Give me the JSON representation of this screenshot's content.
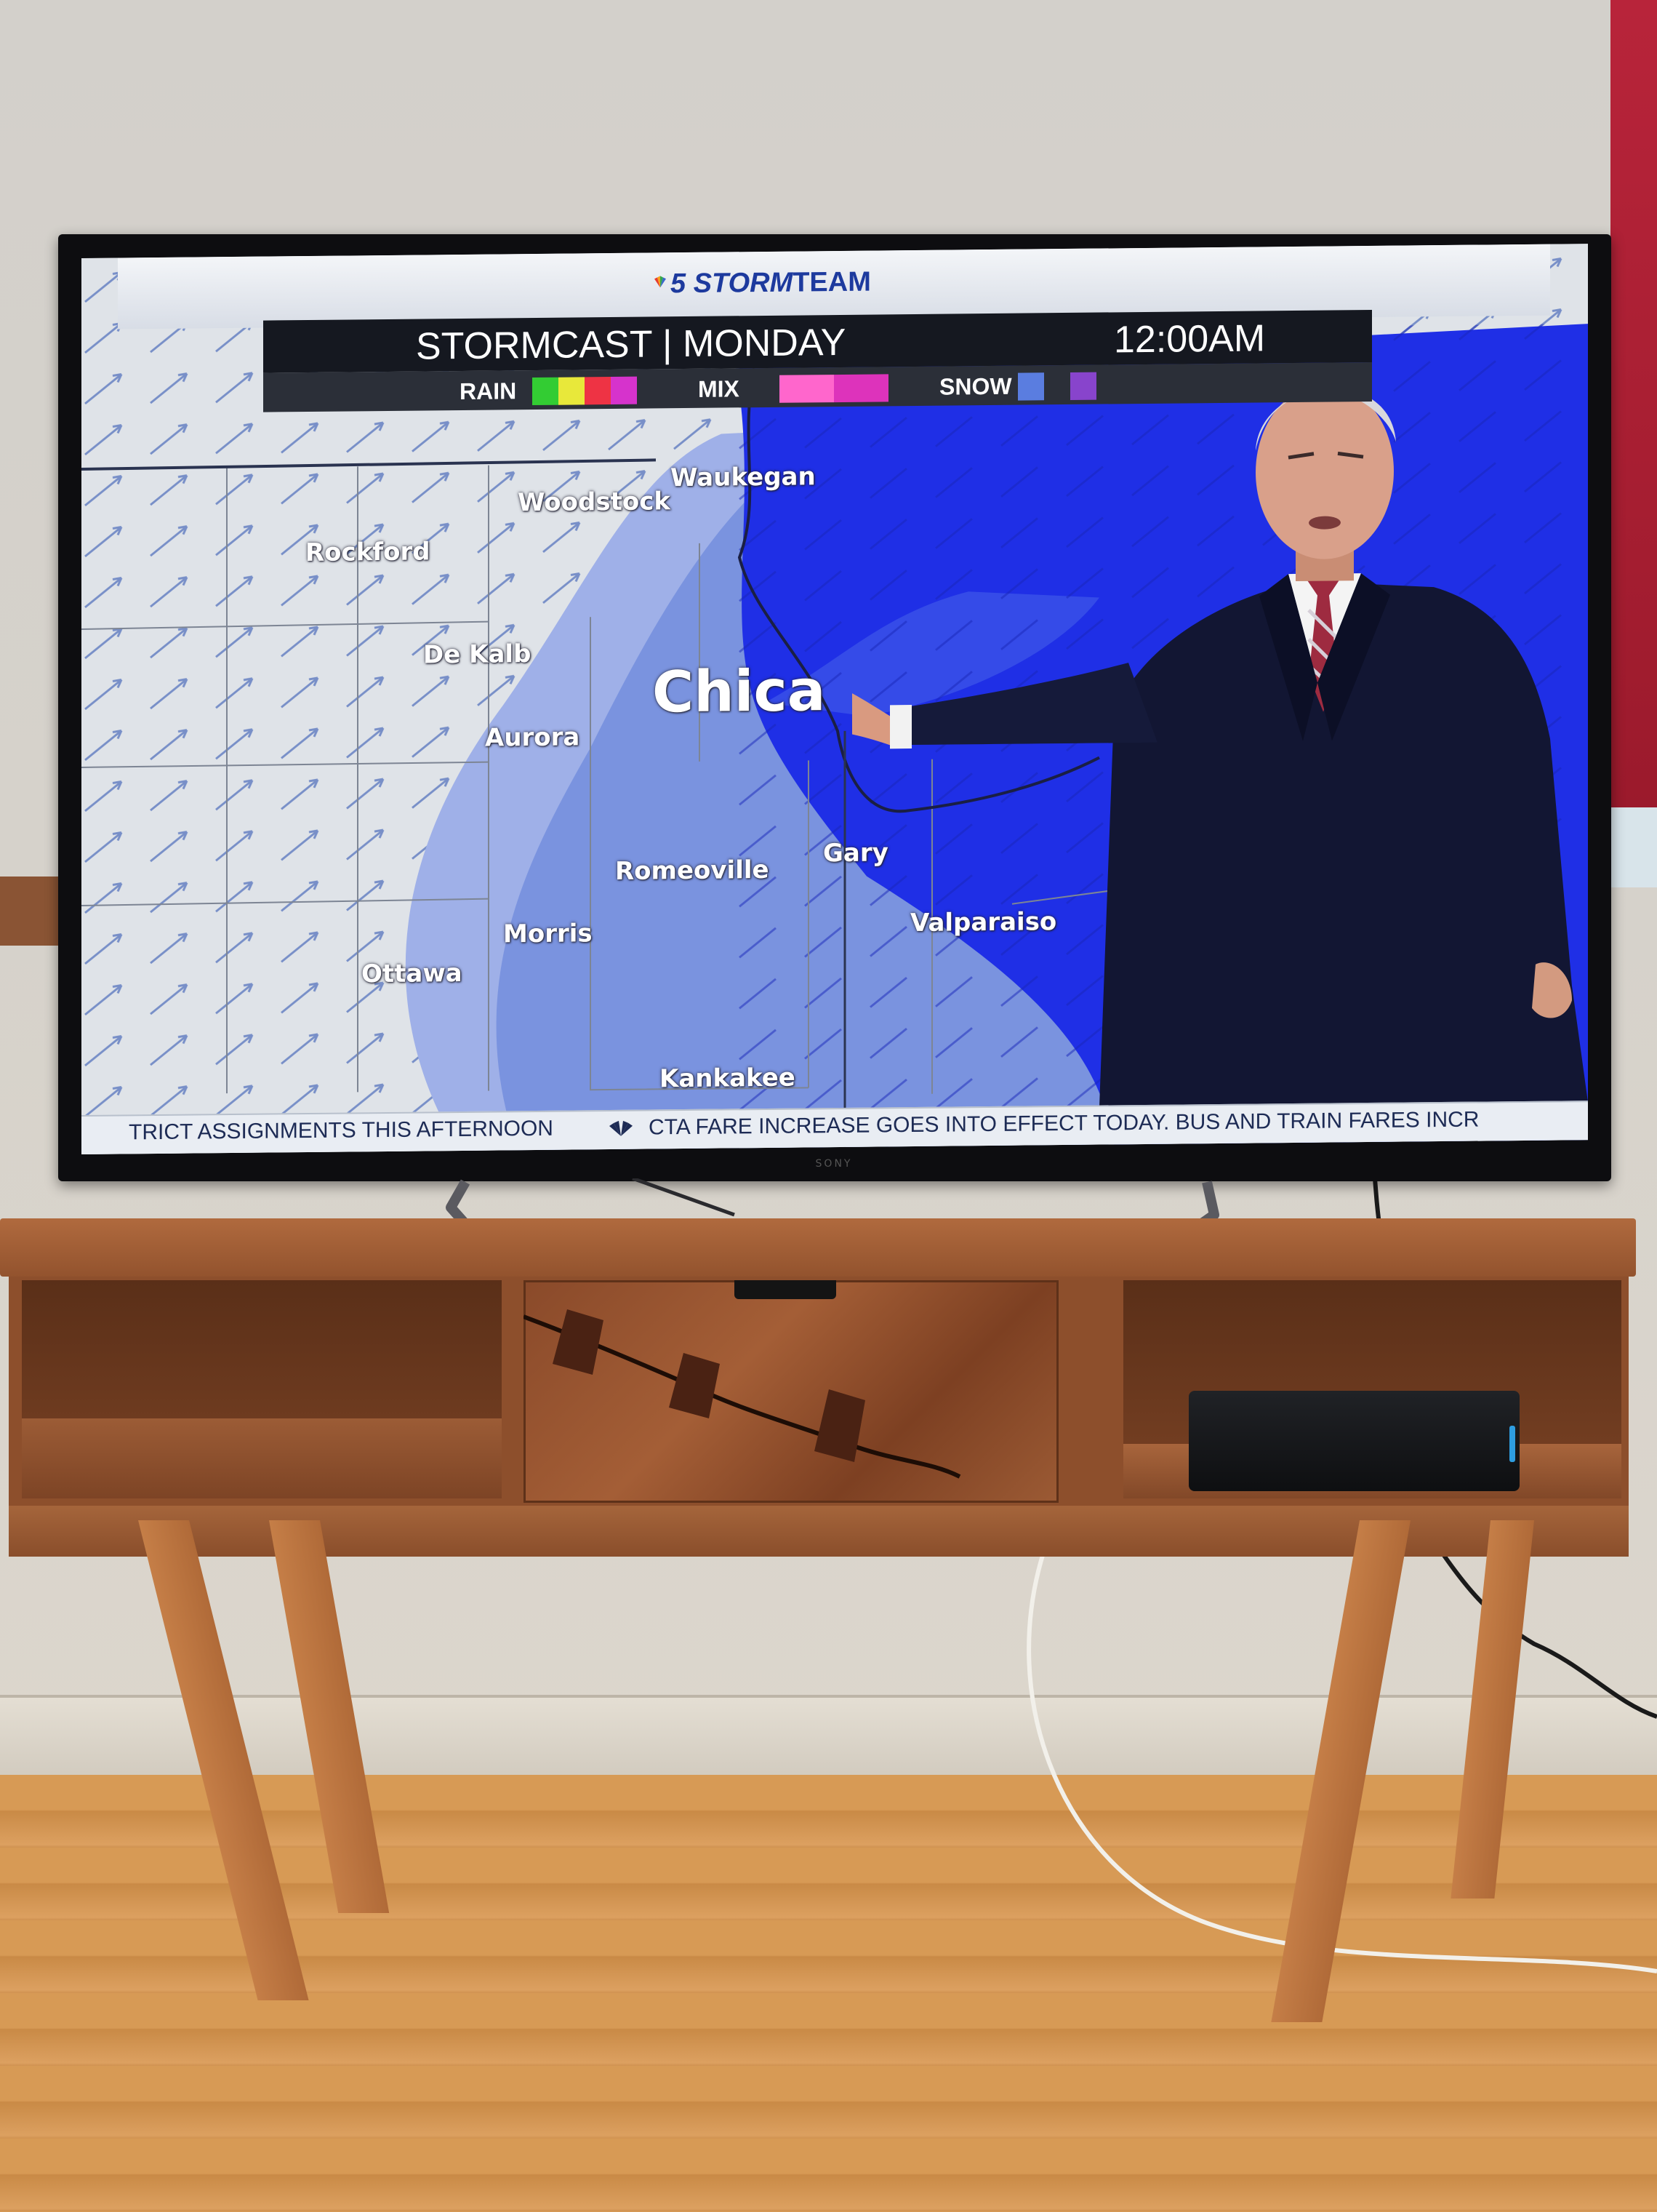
{
  "broadcast": {
    "logo": "5 STORMTEAM",
    "logo_prefix": "5 STORM",
    "logo_suffix": "TEAM",
    "title": "STORMCAST | MONDAY",
    "time": "12:00AM"
  },
  "legend": {
    "rain_label": "RAIN",
    "mix_label": "MIX",
    "snow_label": "SNOW",
    "rain_colors": [
      "#33cc33",
      "#e8e83a",
      "#ee3344",
      "#d633cc"
    ],
    "mix_colors": [
      "#ff66cc",
      "#dd33bb"
    ],
    "snow_colors": [
      "#5a7de0",
      "#8844cc",
      "#cc33cc"
    ]
  },
  "map": {
    "cities": [
      {
        "name": "Waukegan"
      },
      {
        "name": "Woodstock"
      },
      {
        "name": "Rockford"
      },
      {
        "name": "De Kalb"
      },
      {
        "name": "Chica"
      },
      {
        "name": "Aurora"
      },
      {
        "name": "Gary"
      },
      {
        "name": "Romeoville"
      },
      {
        "name": "Valparaiso"
      },
      {
        "name": "Morris"
      },
      {
        "name": "Ottawa"
      },
      {
        "name": "Kankakee"
      }
    ],
    "snow_color": "#1f2fe6",
    "light_snow_color": "#7a93df"
  },
  "ticker": {
    "text_left": "TRICT ASSIGNMENTS THIS AFTERNOON",
    "text_right": "CTA FARE INCREASE GOES INTO EFFECT TODAY. BUS AND TRAIN FARES INCR"
  },
  "tv": {
    "brand": "SONY"
  }
}
